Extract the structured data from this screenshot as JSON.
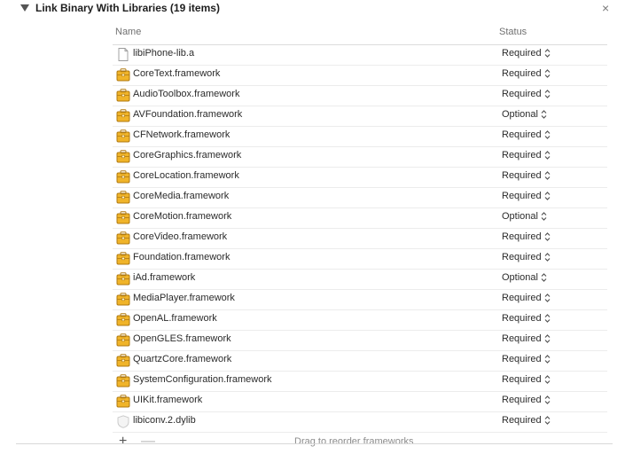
{
  "phase": {
    "title": "Link Binary With Libraries (19 items)"
  },
  "table": {
    "columns": {
      "name": "Name",
      "status": "Status"
    },
    "rows": [
      {
        "name": "libiPhone-lib.a",
        "status": "Required",
        "icon": "file-icon"
      },
      {
        "name": "CoreText.framework",
        "status": "Required",
        "icon": "framework-icon"
      },
      {
        "name": "AudioToolbox.framework",
        "status": "Required",
        "icon": "framework-icon"
      },
      {
        "name": "AVFoundation.framework",
        "status": "Optional",
        "icon": "framework-icon"
      },
      {
        "name": "CFNetwork.framework",
        "status": "Required",
        "icon": "framework-icon"
      },
      {
        "name": "CoreGraphics.framework",
        "status": "Required",
        "icon": "framework-icon"
      },
      {
        "name": "CoreLocation.framework",
        "status": "Required",
        "icon": "framework-icon"
      },
      {
        "name": "CoreMedia.framework",
        "status": "Required",
        "icon": "framework-icon"
      },
      {
        "name": "CoreMotion.framework",
        "status": "Optional",
        "icon": "framework-icon"
      },
      {
        "name": "CoreVideo.framework",
        "status": "Required",
        "icon": "framework-icon"
      },
      {
        "name": "Foundation.framework",
        "status": "Required",
        "icon": "framework-icon"
      },
      {
        "name": "iAd.framework",
        "status": "Optional",
        "icon": "framework-icon"
      },
      {
        "name": "MediaPlayer.framework",
        "status": "Required",
        "icon": "framework-icon"
      },
      {
        "name": "OpenAL.framework",
        "status": "Required",
        "icon": "framework-icon"
      },
      {
        "name": "OpenGLES.framework",
        "status": "Required",
        "icon": "framework-icon"
      },
      {
        "name": "QuartzCore.framework",
        "status": "Required",
        "icon": "framework-icon"
      },
      {
        "name": "SystemConfiguration.framework",
        "status": "Required",
        "icon": "framework-icon"
      },
      {
        "name": "UIKit.framework",
        "status": "Required",
        "icon": "framework-icon"
      },
      {
        "name": "libiconv.2.dylib",
        "status": "Required",
        "icon": "dylib-icon"
      }
    ]
  },
  "footer": {
    "add_symbol": "+",
    "remove_symbol": "—",
    "hint": "Drag to reorder frameworks"
  },
  "close_symbol": "×",
  "colors": {
    "framework_icon_fill": "#f0b429",
    "framework_icon_stroke": "#b07a10",
    "row_divider": "#ececec"
  }
}
